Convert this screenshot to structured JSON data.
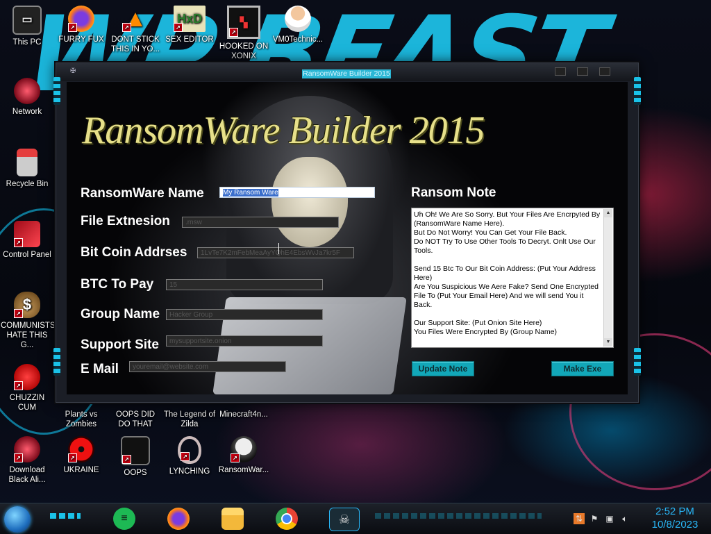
{
  "window": {
    "title": "RansomWare Builder 2015",
    "heading": "RansomWare Builder 2015",
    "icon": "skull-icon"
  },
  "form": {
    "ransomware_name_label": "RansomWare Name",
    "ransomware_name_value": "My Ransom Ware",
    "file_extension_label": "File Extnesion",
    "file_extension_value": ".rnsw",
    "bitcoin_address_label": "Bit Coin Addrses",
    "bitcoin_address_value": "1LvTe7K2mFebMeaAyYQhE4EbsWvJa7kr5F",
    "btc_to_pay_label": "BTC To Pay",
    "btc_to_pay_value": "15",
    "group_name_label": "Group Name",
    "group_name_value": "Hacker Group",
    "support_site_label": "Support Site",
    "support_site_value": "mysupportsite.onion",
    "email_label": "E Mail",
    "email_value": "youremail@website.com"
  },
  "note": {
    "title": "Ransom Note",
    "text": "Uh Oh! We Are So Sorry. But Your Files Are Encrpyted By (RansomWare Name Here).\nBut Do Not Worry! You Can Get Your File Back.\nDo NOT Try To Use Other Tools To Decryt. Onlt Use Our Tools.\n\nSend 15 Btc To Our Bit Coin Address: (Put Your Address Here)\nAre You Suspicious We Aere Fake? Send One Encrypted File To (Put Your Email Here) And we will send You it Back.\n\nOur Support Site: (Put Onion Site Here)\nYou Files Were Encrypted By (Group Name)"
  },
  "buttons": {
    "update_note": "Update Note",
    "make_exe": "Make Exe"
  },
  "desktop_icons": [
    {
      "label": "This PC",
      "icon": "computer-icon"
    },
    {
      "label": "FURRY FUX",
      "icon": "firefox-icon"
    },
    {
      "label": "DONT STICK THIS IN YO...",
      "icon": "vlc-cone-icon"
    },
    {
      "label": "SEX EDITOR",
      "icon": "hxd-editor-icon"
    },
    {
      "label": "HOOKED ON XONIX",
      "icon": "xonix-game-icon"
    },
    {
      "label": "VM0Technic...",
      "icon": "doctor-icon"
    },
    {
      "label": "Network",
      "icon": "network-icon"
    },
    {
      "label": "Recycle Bin",
      "icon": "recycle-bin-icon"
    },
    {
      "label": "Control Panel",
      "icon": "control-panel-icon"
    },
    {
      "label": "COMMUNISTS HATE THIS G...",
      "icon": "money-bag-icon"
    },
    {
      "label": "CHUZZIN CUM",
      "icon": "chuzzle-icon"
    },
    {
      "label": "Plants vs Zombies",
      "icon": "plants-vs-zombies-icon"
    },
    {
      "label": "OOPS DID DO THAT",
      "icon": "oops-icon"
    },
    {
      "label": "The Legend of Zilda",
      "icon": "zelda-icon"
    },
    {
      "label": "Minecraft4n...",
      "icon": "minecraft-icon"
    },
    {
      "label": "Download Black Ali...",
      "icon": "download-icon"
    },
    {
      "label": "UKRAINE",
      "icon": "radiation-icon"
    },
    {
      "label": "OOPS",
      "icon": "oops-screen-icon"
    },
    {
      "label": "LYNCHING",
      "icon": "noose-icon"
    },
    {
      "label": "RansomWar...",
      "icon": "skull-icon"
    }
  ],
  "taskbar": {
    "apps": [
      "spotify-icon",
      "firefox-icon",
      "file-explorer-icon",
      "chrome-icon",
      "skull-icon"
    ],
    "time": "2:52 PM",
    "date": "10/8/2023"
  }
}
